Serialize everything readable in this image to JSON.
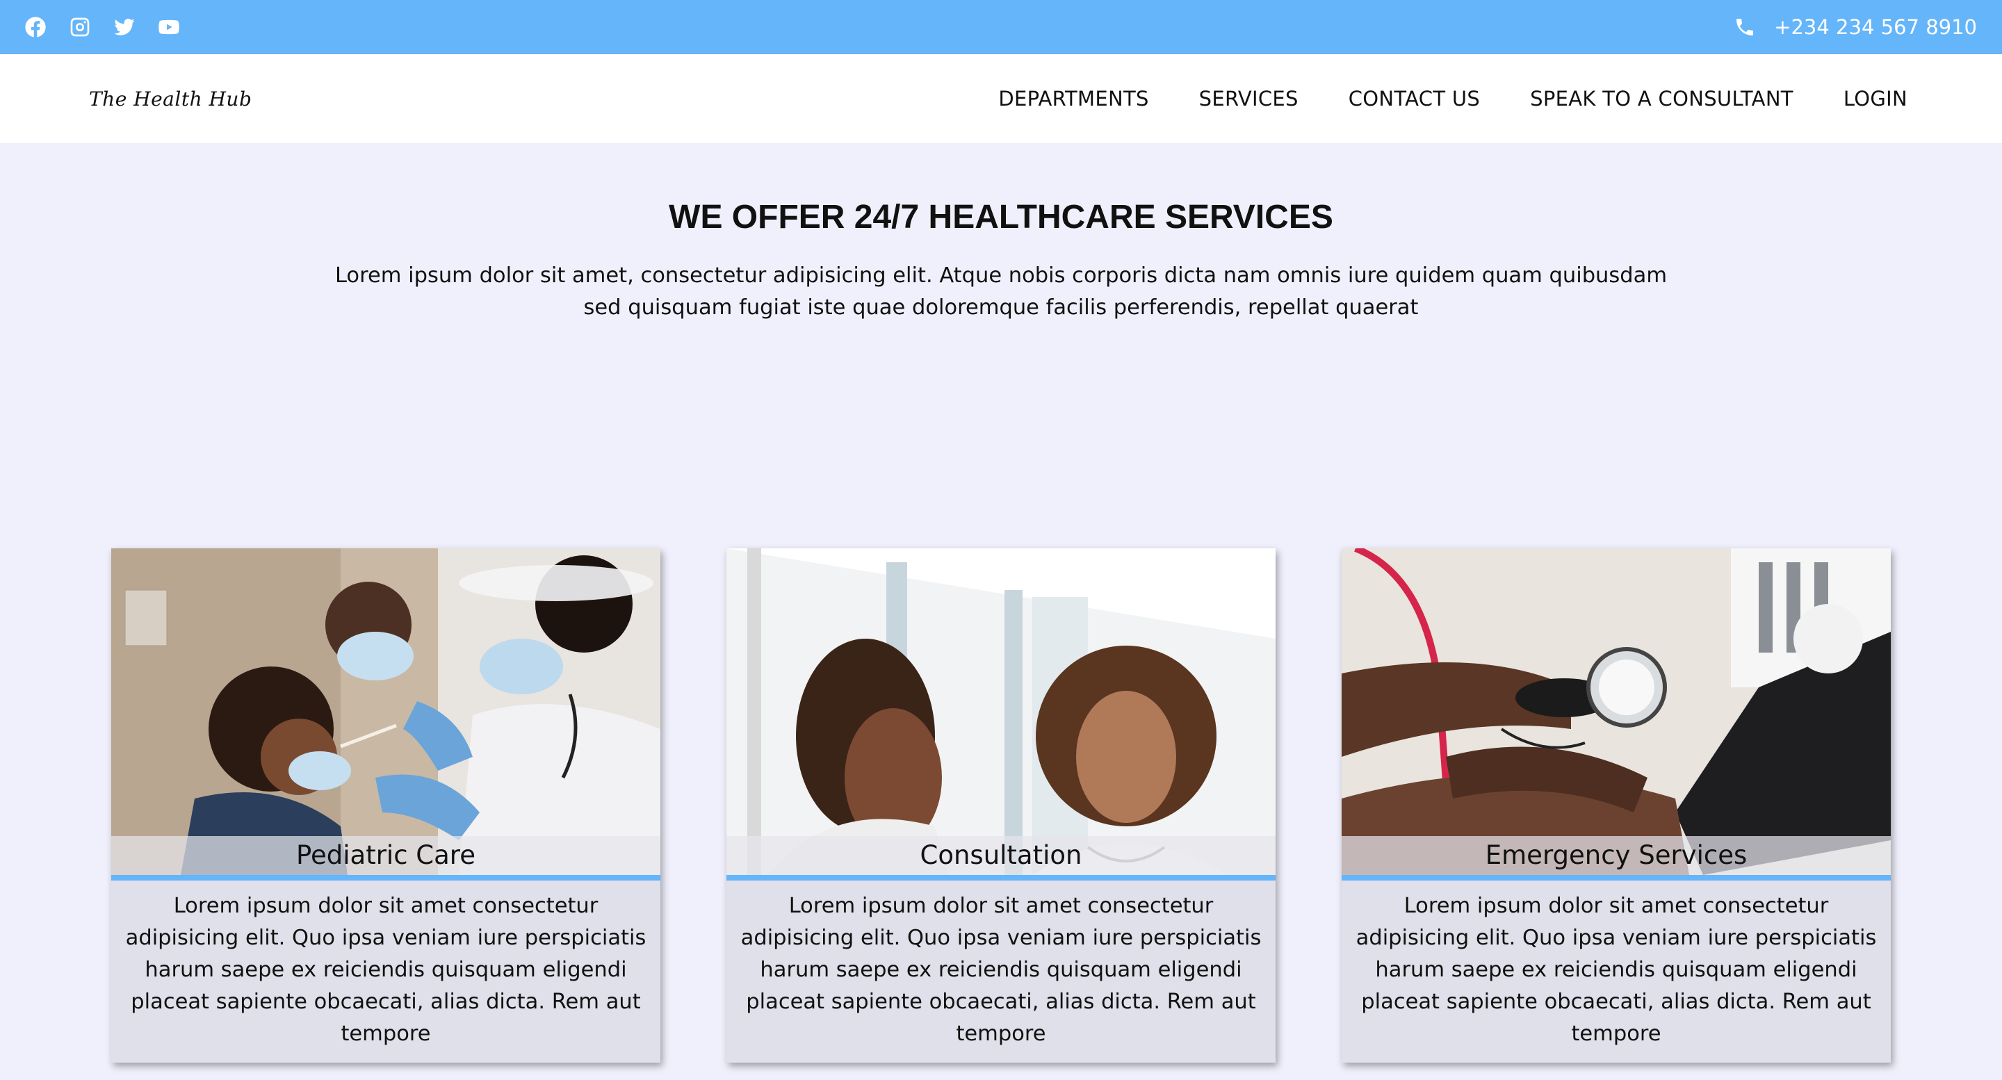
{
  "topbar": {
    "social_icons": [
      "facebook-icon",
      "instagram-icon",
      "twitter-icon",
      "youtube-icon"
    ],
    "phone_icon": "phone-icon",
    "phone": "+234 234 567 8910",
    "color": "#64b5f9"
  },
  "nav": {
    "logo": "The Health Hub",
    "items": [
      "DEPARTMENTS",
      "SERVICES",
      "CONTACT US",
      "SPEAK TO A CONSULTANT",
      "LOGIN"
    ]
  },
  "hero": {
    "title": "WE OFFER 24/7 HEALTHCARE SERVICES",
    "text": "Lorem ipsum dolor sit amet, consectetur adipisicing elit. Atque nobis corporis dicta nam omnis iure quidem quam quibusdam sed quisquam fugiat iste quae doloremque facilis perferendis, repellat quaerat"
  },
  "cards": [
    {
      "title": "Pediatric Care",
      "text": "Lorem ipsum dolor sit amet consectetur adipisicing elit. Quo ipsa veniam iure perspiciatis harum saepe ex reiciendis quisquam eligendi placeat sapiente obcaecati, alias dicta. Rem aut tempore"
    },
    {
      "title": "Consultation",
      "text": "Lorem ipsum dolor sit amet consectetur adipisicing elit. Quo ipsa veniam iure perspiciatis harum saepe ex reiciendis quisquam eligendi placeat sapiente obcaecati, alias dicta. Rem aut tempore"
    },
    {
      "title": "Emergency Services",
      "text": "Lorem ipsum dolor sit amet consectetur adipisicing elit. Quo ipsa veniam iure perspiciatis harum saepe ex reiciendis quisquam eligendi placeat sapiente obcaecati, alias dicta. Rem aut tempore"
    }
  ],
  "colors": {
    "accent": "#64b5f9",
    "page_bg": "#f0f0fc",
    "card_bg": "#e0e0ea"
  }
}
